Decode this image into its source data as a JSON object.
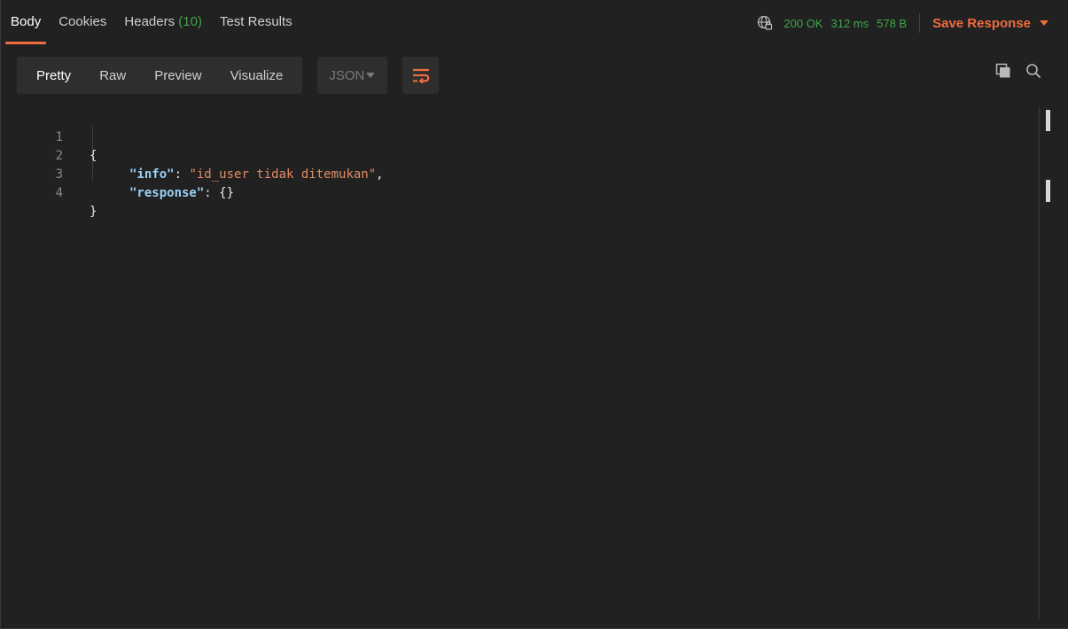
{
  "response_tabs": [
    {
      "label": "Body",
      "count": ""
    },
    {
      "label": "Cookies",
      "count": ""
    },
    {
      "label": "Headers",
      "count": "(10)"
    },
    {
      "label": "Test Results",
      "count": ""
    }
  ],
  "status": {
    "code": "200 OK",
    "time": "312 ms",
    "size": "578 B"
  },
  "save_response_label": "Save Response",
  "format_tabs": [
    "Pretty",
    "Raw",
    "Preview",
    "Visualize"
  ],
  "format_selected": "Pretty",
  "language": "JSON",
  "body_lines": [
    {
      "num": "1"
    },
    {
      "num": "2",
      "key": "\"info\"",
      "colon": ": ",
      "value": "\"id_user tidak ditemukan\"",
      "tail": ","
    },
    {
      "num": "3",
      "key": "\"response\"",
      "colon": ": ",
      "value": "",
      "tail": "{}"
    },
    {
      "num": "4"
    }
  ],
  "open_brace": "{",
  "close_brace": "}",
  "colors": {
    "accent": "#ef6c3e",
    "status_green": "#3fa64a",
    "json_key": "#9ad1f5",
    "json_string": "#e08c64",
    "background": "#212121"
  },
  "icons": [
    "globe-lock-icon",
    "wrap-lines-icon",
    "copy-icon",
    "search-icon",
    "chevron-down-icon"
  ]
}
